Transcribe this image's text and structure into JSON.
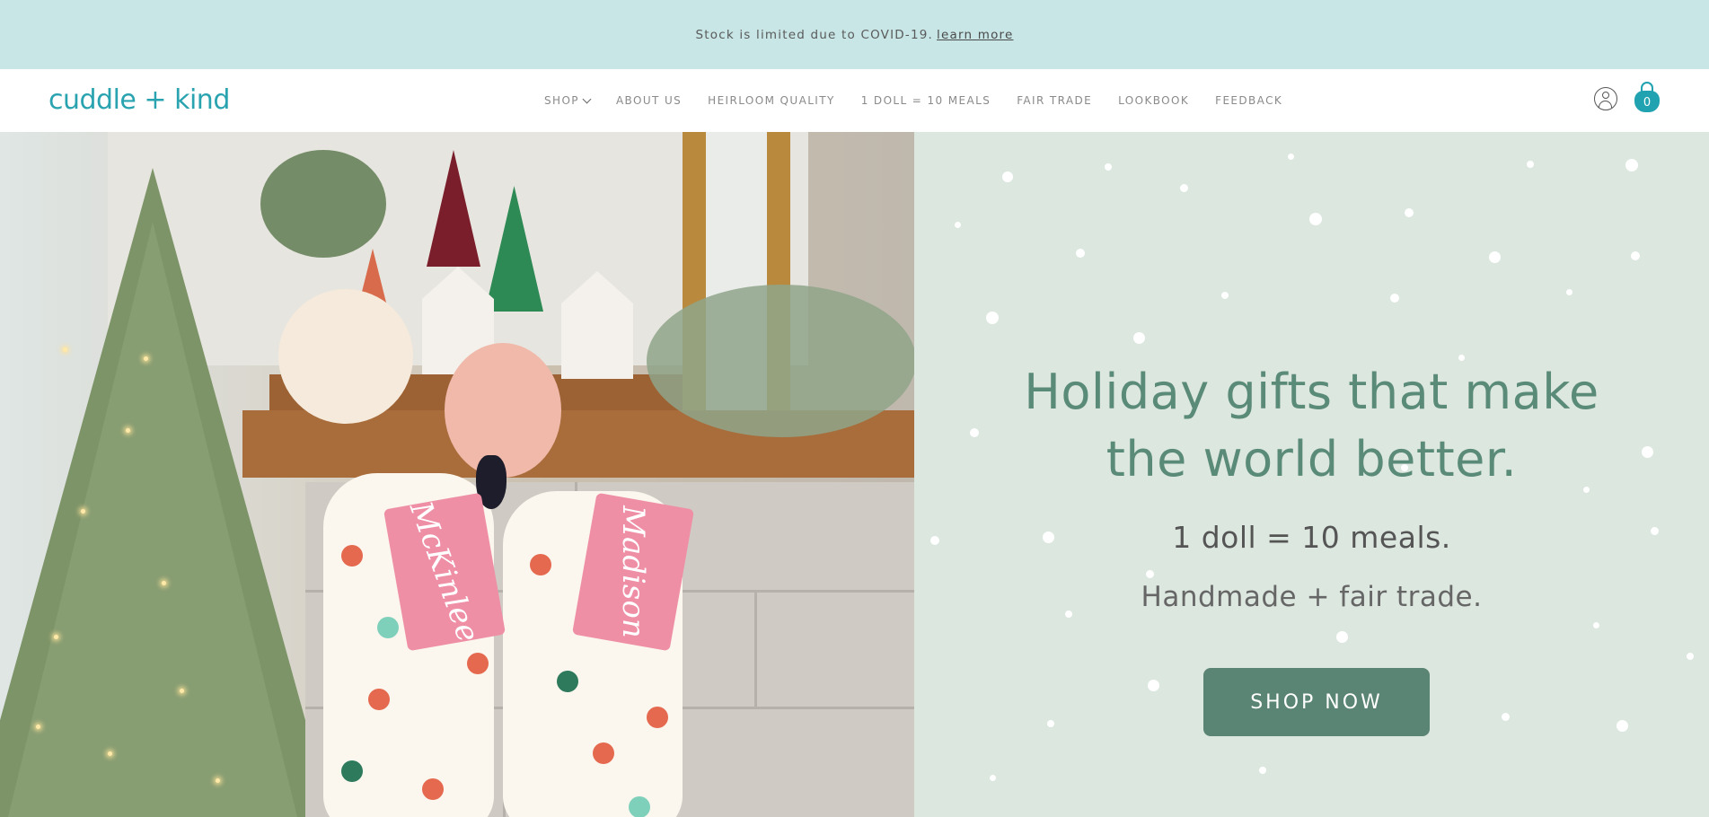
{
  "announcement": {
    "text": "Stock is limited due to COVID-19.",
    "link": "learn more"
  },
  "header": {
    "logo": "cuddle + kind",
    "nav": [
      {
        "label": "SHOP"
      },
      {
        "label": "ABOUT US"
      },
      {
        "label": "HEIRLOOM QUALITY"
      },
      {
        "label": "1 DOLL = 10 MEALS"
      },
      {
        "label": "FAIR TRADE"
      },
      {
        "label": "LOOKBOOK"
      },
      {
        "label": "FEEDBACK"
      }
    ],
    "cart_count": "0",
    "icons": {
      "account": "account-icon",
      "cart": "cart-icon",
      "dropdown": "chevron-down-icon"
    }
  },
  "hero": {
    "headline_line1": "Holiday gifts that make",
    "headline_line2": "the world better.",
    "subtitle1": "1 doll = 10 meals.",
    "subtitle2": "Handmade + fair trade.",
    "cta": "SHOP NOW",
    "tags": [
      "McKinlee",
      "Madison"
    ]
  },
  "colors": {
    "announcement_bg": "#c8e6e6",
    "brand": "#2aa3b0",
    "panel_bg": "#dce7df",
    "headline": "#5a8a78",
    "button": "#5a8473"
  }
}
